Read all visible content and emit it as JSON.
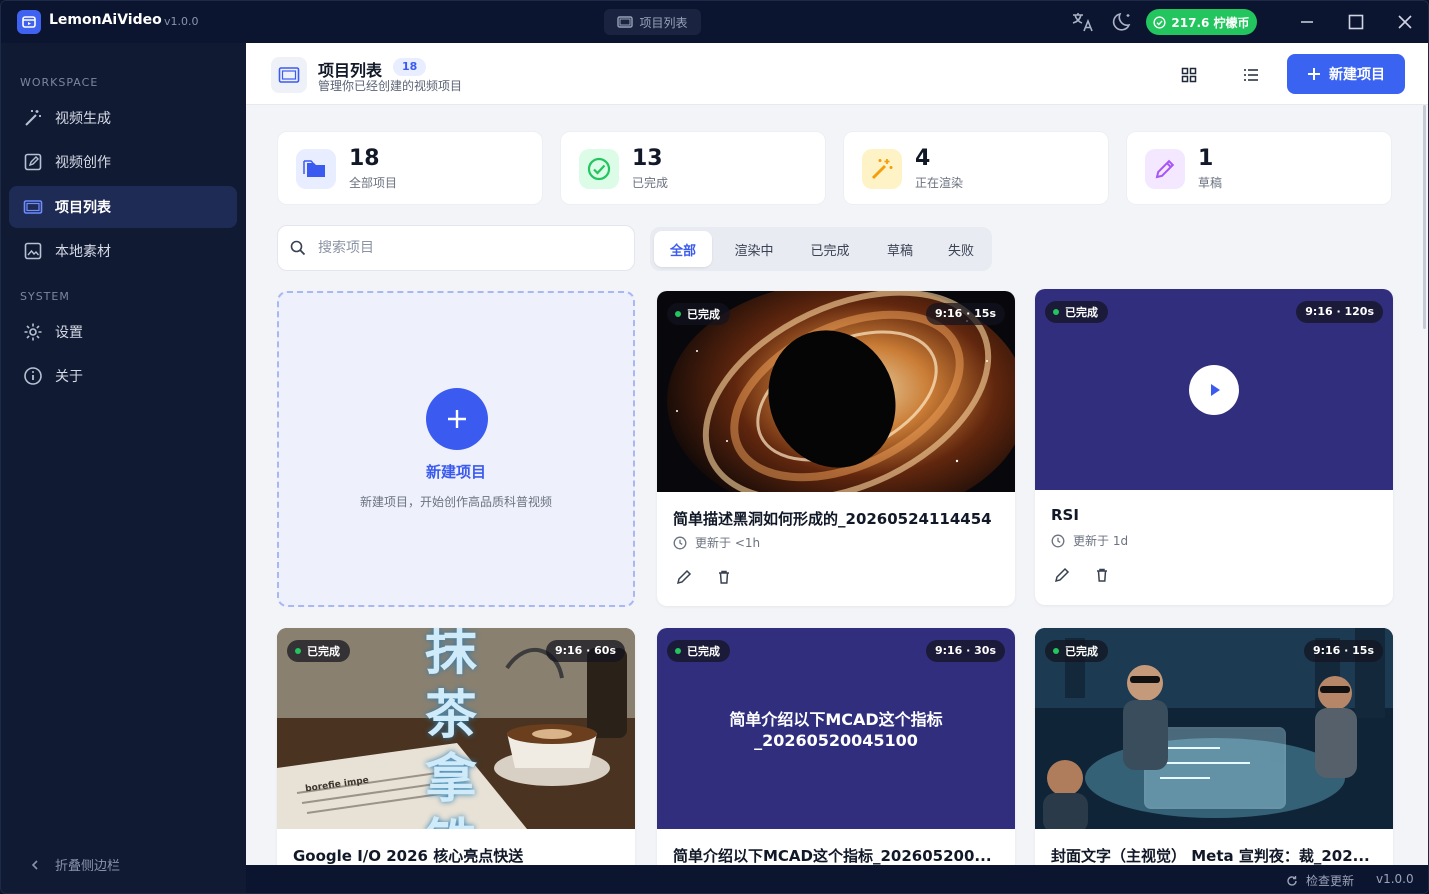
{
  "titlebar": {
    "app_name": "LemonAiVideo",
    "version": "v1.0.0",
    "center_tab": "项目列表",
    "coins": "217.6 柠檬币"
  },
  "sidebar": {
    "workspace_title": "WORKSPACE",
    "system_title": "SYSTEM",
    "items": [
      {
        "label": "视频生成",
        "icon": "magic-wand-icon"
      },
      {
        "label": "视频创作",
        "icon": "edit-square-icon"
      },
      {
        "label": "项目列表",
        "icon": "folder-icon",
        "active": true
      },
      {
        "label": "本地素材",
        "icon": "image-icon"
      }
    ],
    "system_items": [
      {
        "label": "设置",
        "icon": "gear-icon"
      },
      {
        "label": "关于",
        "icon": "info-icon"
      }
    ],
    "collapse_label": "折叠侧边栏"
  },
  "header": {
    "title": "项目列表",
    "count": "18",
    "subtitle": "管理你已经创建的视频项目",
    "new_button": "新建项目"
  },
  "stats": [
    {
      "value": "18",
      "label": "全部项目",
      "color": "#3b5bf0"
    },
    {
      "value": "13",
      "label": "已完成",
      "color": "#22c55e"
    },
    {
      "value": "4",
      "label": "正在渲染",
      "color": "#f59e0b"
    },
    {
      "value": "1",
      "label": "草稿",
      "color": "#a855f7"
    }
  ],
  "search": {
    "placeholder": "搜索项目"
  },
  "filters": [
    "全部",
    "渲染中",
    "已完成",
    "草稿",
    "失败"
  ],
  "new_card": {
    "title": "新建项目",
    "subtitle": "新建项目，开始创作高品质科普视频"
  },
  "projects": [
    {
      "status": "已完成",
      "duration": "9:16 · 15s",
      "title": "简单描述黑洞如何形成的_20260524114454",
      "updated": "更新于 <1h"
    },
    {
      "status": "已完成",
      "duration": "9:16 · 120s",
      "title": "RSI",
      "updated": "更新于 1d"
    },
    {
      "status": "已完成",
      "duration": "9:16 · 60s",
      "title": "Google I/O 2026 核心亮点快送",
      "thumb_text": "抹茶拿铁",
      "paper_text": "borefie impe"
    },
    {
      "status": "已完成",
      "duration": "9:16 · 30s",
      "title": "简单介绍以下MCAD这个指标_202605200...",
      "thumb_line1": "简单介绍以下MCAD这个指标",
      "thumb_line2": "_20260520045100"
    },
    {
      "status": "已完成",
      "duration": "9:16 · 15s",
      "title": "封面文字（主视觉） Meta 宣判夜：裁_202..."
    }
  ],
  "statusbar": {
    "check_update": "检查更新",
    "version": "v1.0.0"
  },
  "colors": {
    "accent": "#3b5bf0",
    "sidebar_bg": "#101a33",
    "success": "#22c55e"
  }
}
